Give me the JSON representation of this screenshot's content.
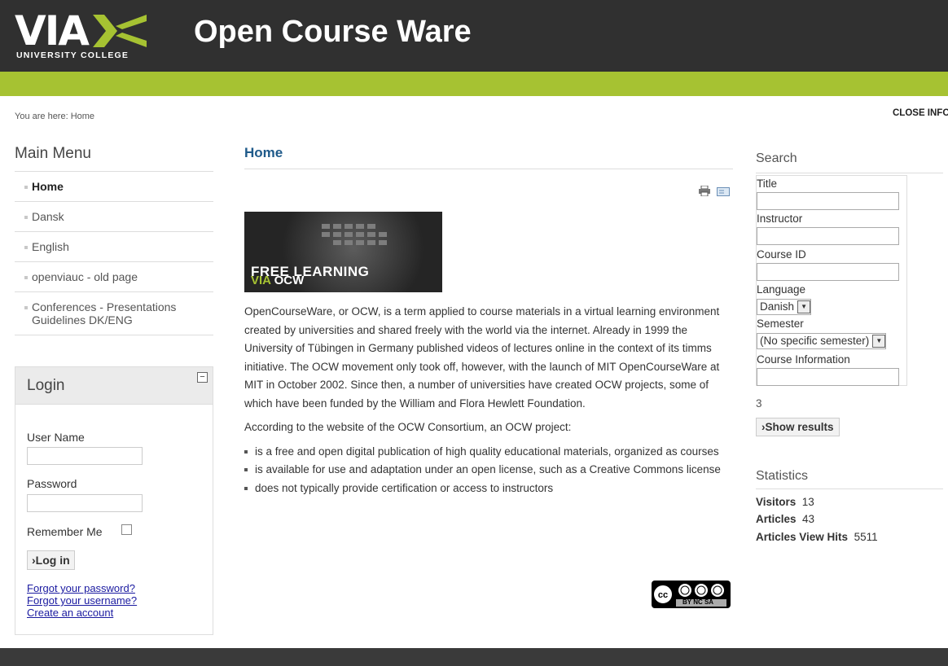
{
  "header": {
    "logo_text": "VIA",
    "logo_subtext": "UNIVERSITY COLLEGE",
    "site_title": "Open Course Ware"
  },
  "breadcrumb": "You are here: Home",
  "close_info": "CLOSE INFO",
  "main_menu": {
    "title": "Main Menu",
    "items": [
      {
        "label": "Home",
        "active": true
      },
      {
        "label": "Dansk"
      },
      {
        "label": "English"
      },
      {
        "label": "openviauc - old page"
      },
      {
        "label": "Conferences - Presentations Guidelines DK/ENG"
      }
    ]
  },
  "login": {
    "title": "Login",
    "username_label": "User Name",
    "password_label": "Password",
    "remember_label": "Remember Me",
    "login_button": "›Log in",
    "links": [
      "Forgot your password?",
      "Forgot your username?",
      "Create an account"
    ]
  },
  "main": {
    "title": "Home",
    "banner_line1": "FREE LEARNING",
    "banner_via": "VIA",
    "banner_ocw": " OCW",
    "paragraphs": [
      "OpenCourseWare, or OCW, is a term applied to course materials in a virtual learning environment created by universities and shared freely with the world via the internet. Already in 1999 the University of Tübingen in Germany published videos of lectures online in the context of its timms initiative. The OCW movement only took off, however, with the launch of MIT OpenCourseWare at MIT in October 2002. Since then, a number of universities have created OCW projects, some of which have been funded by the William and Flora Hewlett Foundation.",
      "According to the website of the OCW Consortium, an OCW project:"
    ],
    "bullets": [
      "is a free and open digital publication of high quality educational materials, organized as courses",
      "is available for use and adaptation under an open license, such as a Creative Commons license",
      "does not typically provide certification or access to instructors"
    ],
    "cc_badge": "BY NC SA"
  },
  "search": {
    "title": "Search",
    "fields": {
      "title_label": "Title",
      "instructor_label": "Instructor",
      "course_id_label": "Course ID",
      "language_label": "Language",
      "language_value": "Danish",
      "semester_label": "Semester",
      "semester_value": "(No specific semester)",
      "course_info_label": "Course Information"
    },
    "result_count": "3",
    "show_button": "›Show results"
  },
  "statistics": {
    "title": "Statistics",
    "items": [
      {
        "label": "Visitors",
        "value": "13"
      },
      {
        "label": "Articles",
        "value": "43"
      },
      {
        "label": "Articles View Hits",
        "value": "5511"
      }
    ]
  }
}
